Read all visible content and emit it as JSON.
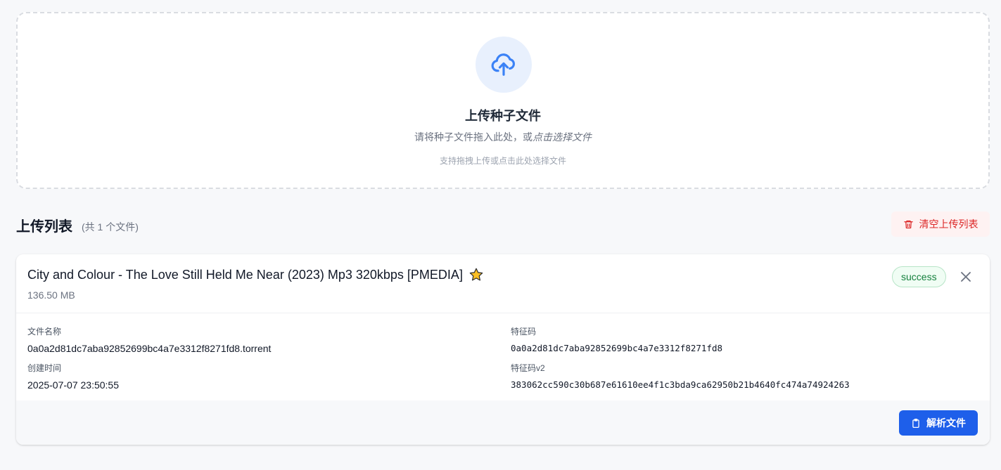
{
  "upload": {
    "title": "上传种子文件",
    "desc_prefix": "请将种子文件拖入此处，或",
    "desc_link": "点击选择文件",
    "hint": "支持拖拽上传或点击此处选择文件",
    "icon": "cloud-upload-icon",
    "accent": "#3b82f6"
  },
  "list": {
    "title": "上传列表",
    "count": "(共 1 个文件)",
    "clear_label": "清空上传列表",
    "clear_icon": "trash-icon"
  },
  "files": [
    {
      "title": "City and Colour - The Love Still Held Me Near (2023) Mp3 320kbps [PMEDIA]",
      "title_icon": "star-icon",
      "size": "136.50 MB",
      "status": "success",
      "fields": {
        "file_name_label": "文件名称",
        "file_name": "0a0a2d81dc7aba92852699bc4a7e3312f8271fd8.torrent",
        "created_label": "创建时间",
        "created": "2025-07-07 23:50:55",
        "hash_label": "特征码",
        "hash": "0a0a2d81dc7aba92852699bc4a7e3312f8271fd8",
        "hash_v2_label": "特征码v2",
        "hash_v2": "383062cc590c30b687e61610ee4f1c3bda9ca62950b21b4640fc474a74924263"
      },
      "parse_label": "解析文件",
      "parse_icon": "clipboard-icon"
    }
  ],
  "colors": {
    "primary": "#1e5fea",
    "danger": "#dc2626",
    "success": "#15803d"
  }
}
